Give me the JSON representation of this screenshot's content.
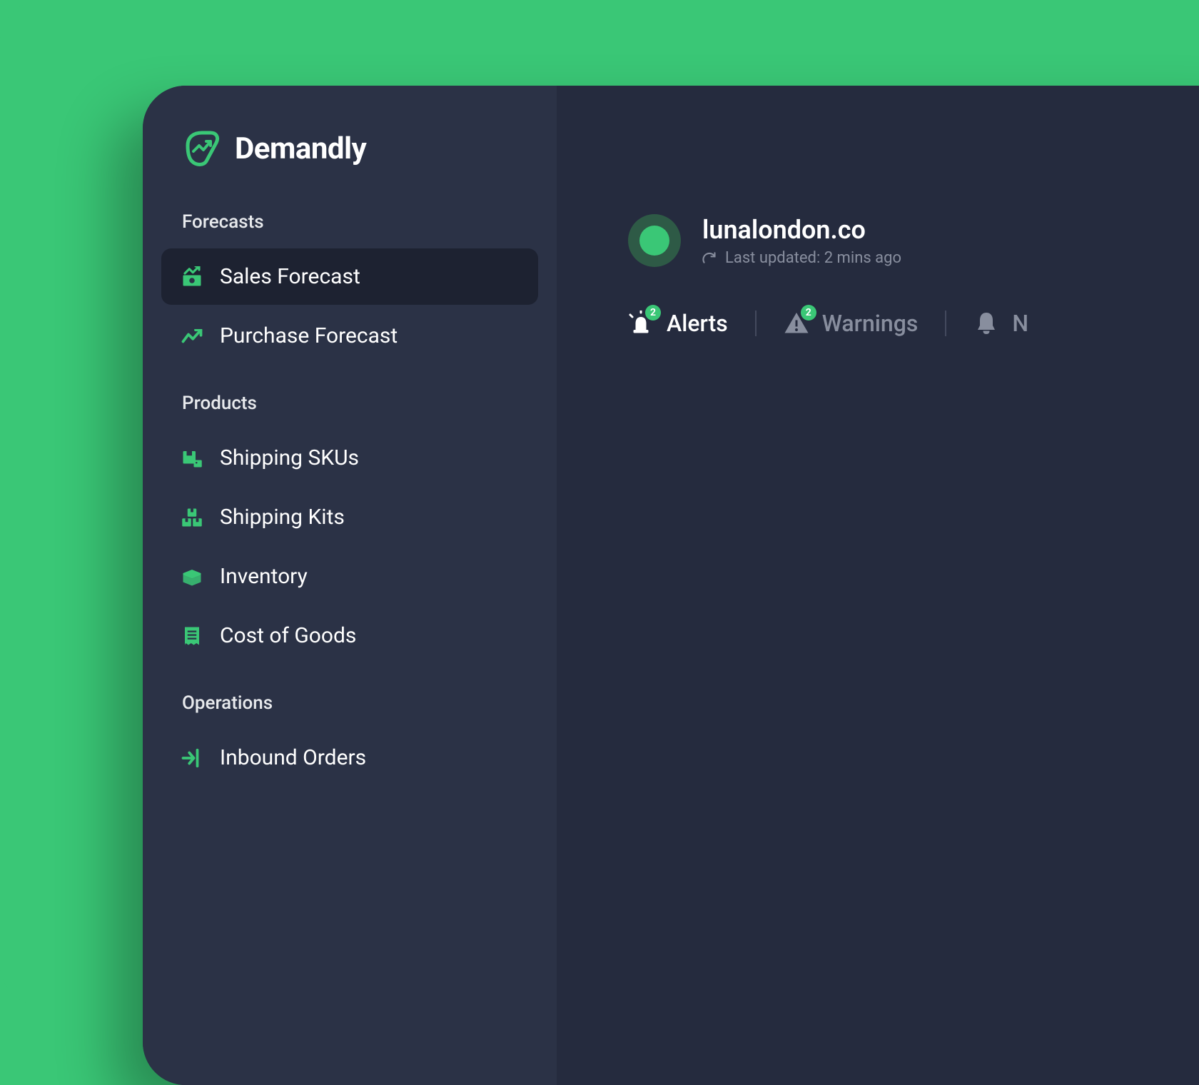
{
  "brand": {
    "name": "Demandly"
  },
  "sidebar": {
    "sections": [
      {
        "title": "Forecasts",
        "items": [
          {
            "label": "Sales Forecast",
            "active": true
          },
          {
            "label": "Purchase Forecast",
            "active": false
          }
        ]
      },
      {
        "title": "Products",
        "items": [
          {
            "label": "Shipping SKUs",
            "active": false
          },
          {
            "label": "Shipping Kits",
            "active": false
          },
          {
            "label": "Inventory",
            "active": false
          },
          {
            "label": "Cost of Goods",
            "active": false
          }
        ]
      },
      {
        "title": "Operations",
        "items": [
          {
            "label": "Inbound Orders",
            "active": false
          }
        ]
      }
    ]
  },
  "site": {
    "name": "lunalondon.co",
    "last_updated": "Last updated: 2 mins ago"
  },
  "tabs": [
    {
      "label": "Alerts",
      "badge": "2",
      "active": true
    },
    {
      "label": "Warnings",
      "badge": "2",
      "active": false
    },
    {
      "label": "N",
      "badge": null,
      "active": false
    }
  ],
  "colors": {
    "accent": "#3ac776",
    "bg_dark": "#252b3e",
    "sidebar_bg": "#2b3246",
    "active_bg": "#1d2231",
    "text_muted": "#888e9e"
  }
}
